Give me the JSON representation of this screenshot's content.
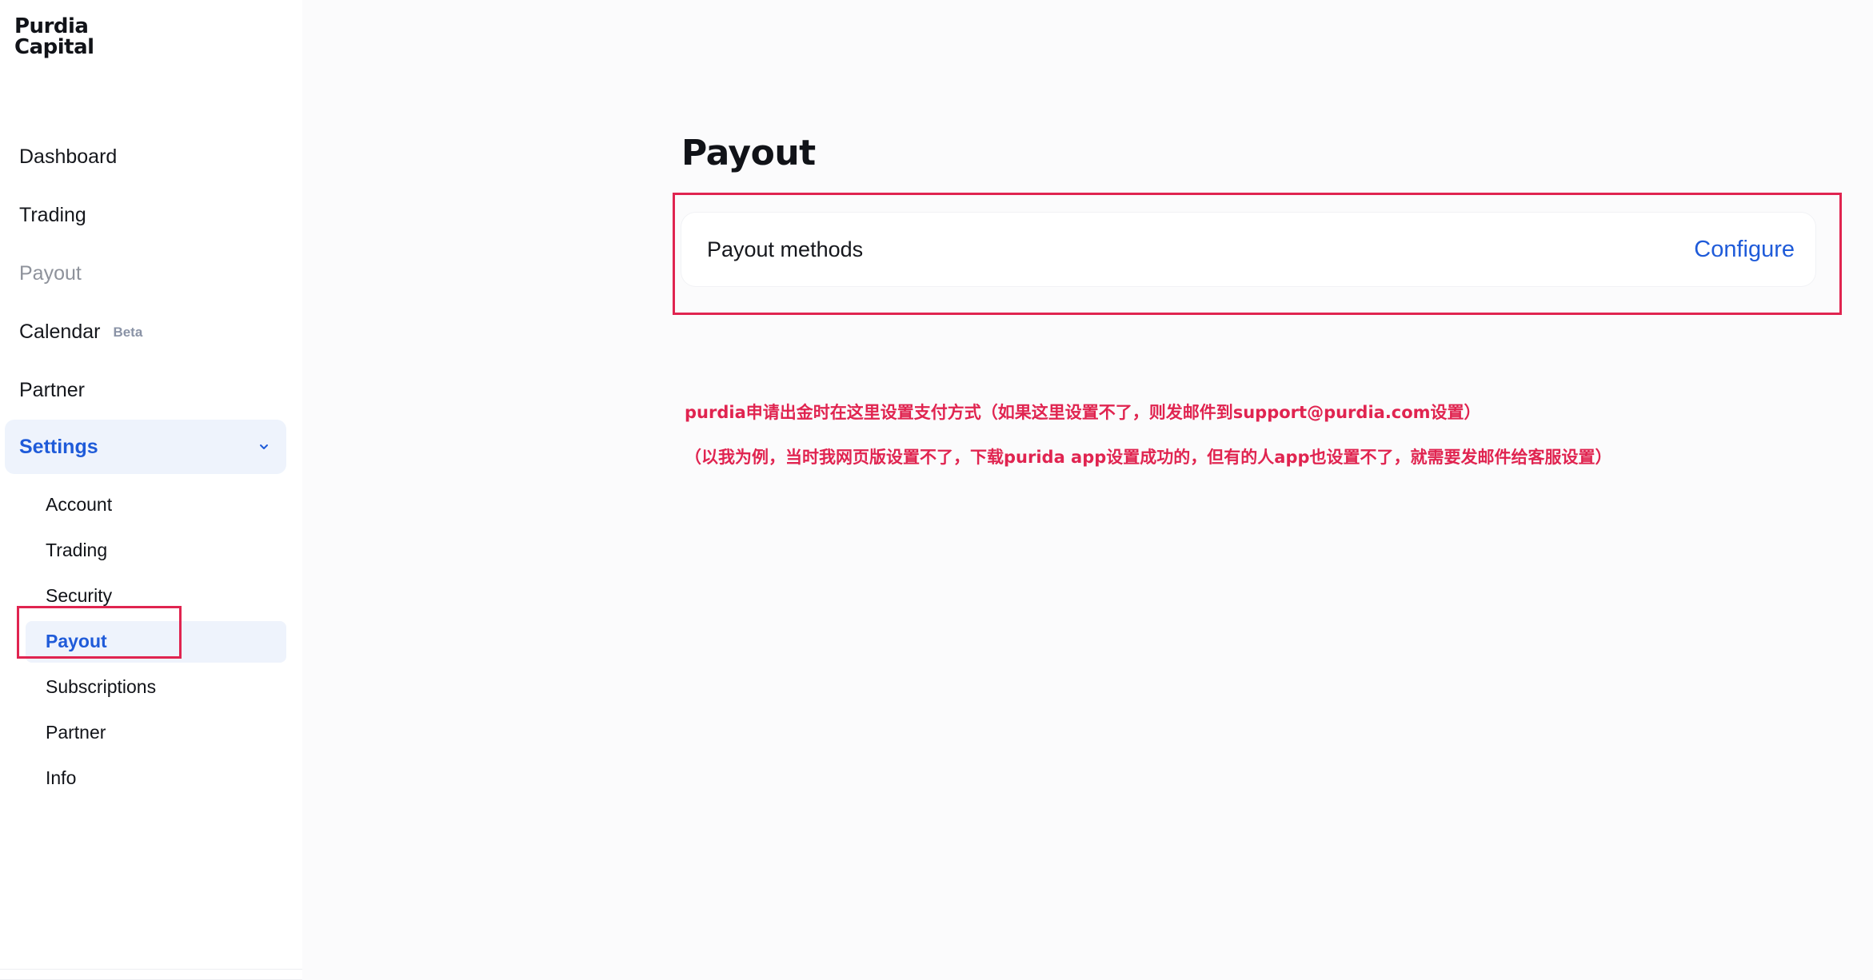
{
  "brand": {
    "line1": "Purdia",
    "line2": "Capital"
  },
  "sidebar": {
    "items": [
      {
        "label": "Dashboard"
      },
      {
        "label": "Trading"
      },
      {
        "label": "Payout"
      },
      {
        "label": "Calendar",
        "badge": "Beta"
      },
      {
        "label": "Partner"
      }
    ],
    "settings": {
      "label": "Settings",
      "expanded": true,
      "children": [
        {
          "label": "Account"
        },
        {
          "label": "Trading"
        },
        {
          "label": "Security"
        },
        {
          "label": "Payout",
          "active": true
        },
        {
          "label": "Subscriptions"
        },
        {
          "label": "Partner"
        },
        {
          "label": "Info"
        }
      ]
    }
  },
  "main": {
    "title": "Payout",
    "card": {
      "label": "Payout methods",
      "action": "Configure"
    },
    "annotations": [
      "purdia申请出金时在这里设置支付方式（如果这里设置不了，则发邮件到support@purdia.com设置）",
      "（以我为例，当时我网页版设置不了，下载purida app设置成功的，但有的人app也设置不了，就需要发邮件给客服设置）"
    ]
  },
  "colors": {
    "accent": "#1f5bd9",
    "active_bg": "#eef3fc",
    "annotation": "#e02450",
    "badge": "#8a93a6",
    "muted": "#8e929b"
  }
}
